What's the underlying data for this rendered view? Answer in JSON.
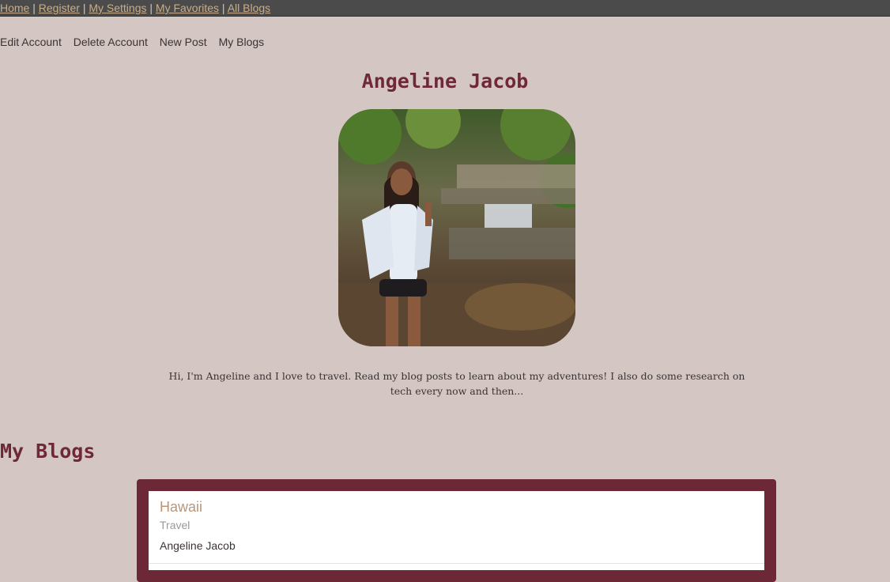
{
  "topnav": {
    "links": [
      "Home",
      "Register",
      "My Settings",
      "My Favorites",
      "All Blogs"
    ],
    "separator": "|"
  },
  "subnav": {
    "items": [
      "Edit Account",
      "Delete Account",
      "New Post",
      "My Blogs"
    ]
  },
  "profile": {
    "name": "Angeline Jacob",
    "bio": "Hi, I'm Angeline and I love to travel. Read my blog posts to learn about my adventures! I also do some research on tech every now and then..."
  },
  "blogs": {
    "heading": "My Blogs",
    "items": [
      {
        "title": "Hawaii",
        "category": "Travel",
        "author": "Angeline Jacob"
      }
    ]
  },
  "colors": {
    "background": "#d3c6c3",
    "accent": "#6f2837",
    "link": "#c9ad8a"
  }
}
